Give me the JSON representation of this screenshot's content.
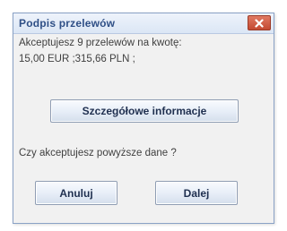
{
  "dialog": {
    "title": "Podpis przelewów",
    "close_icon": "close-x-icon",
    "message_line1": "Akceptujesz 9 przelewów na kwotę:",
    "message_line2": "15,00 EUR ;315,66 PLN ;",
    "details_button": "Szczegółowe informacje",
    "question": "Czy akceptujesz powyższe dane ?",
    "cancel_button": "Anuluj",
    "next_button": "Dalej"
  },
  "colors": {
    "title_text": "#2f4f86",
    "close_button": "#c44a32",
    "background": "#f1f1f1"
  }
}
